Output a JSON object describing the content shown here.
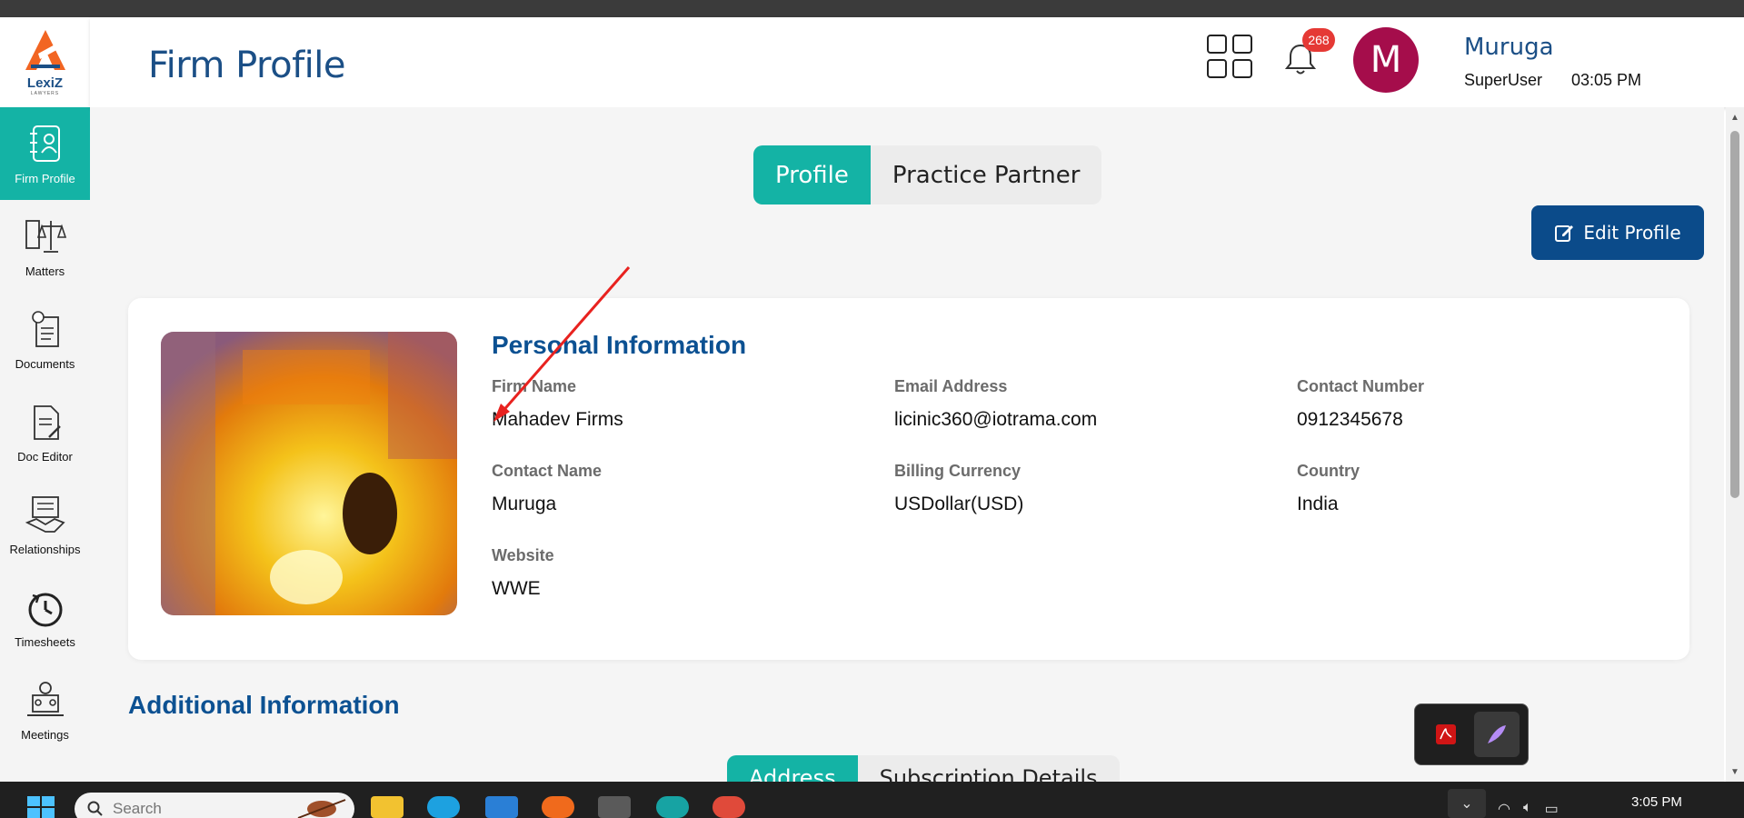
{
  "app": {
    "brand": "LexiZ",
    "tagline": "LAWYERS"
  },
  "header": {
    "title": "Firm Profile",
    "notifications_count": "268",
    "avatar_initial": "M",
    "user_name": "Muruga",
    "user_role": "SuperUser",
    "time": "03:05 PM"
  },
  "sidebar": {
    "items": [
      {
        "label": "Firm Profile",
        "icon": "contact-book-icon",
        "active": true
      },
      {
        "label": "Matters",
        "icon": "scales-icon"
      },
      {
        "label": "Documents",
        "icon": "documents-icon"
      },
      {
        "label": "Doc Editor",
        "icon": "doc-editor-icon"
      },
      {
        "label": "Relationships",
        "icon": "handshake-icon"
      },
      {
        "label": "Timesheets",
        "icon": "clock-icon"
      },
      {
        "label": "Meetings",
        "icon": "meeting-icon"
      }
    ]
  },
  "tabs": {
    "profile": "Profile",
    "practice_partner": "Practice Partner"
  },
  "edit_profile": "Edit Profile",
  "personal": {
    "title": "Personal Information",
    "fields": [
      {
        "label": "Firm Name",
        "value": "Mahadev Firms"
      },
      {
        "label": "Email Address",
        "value": "licinic360@iotrama.com"
      },
      {
        "label": "Contact Number",
        "value": "0912345678"
      },
      {
        "label": "Contact Name",
        "value": "Muruga"
      },
      {
        "label": "Billing Currency",
        "value": "USDollar(USD)"
      },
      {
        "label": "Country",
        "value": "India"
      },
      {
        "label": "Website",
        "value": "WWE"
      }
    ]
  },
  "additional": {
    "title": "Additional Information",
    "tabs": [
      "Address",
      "Subscription Details"
    ]
  },
  "taskbar": {
    "search_placeholder": "Search",
    "clock": "3:05 PM"
  },
  "colors": {
    "accent": "#14b3a5",
    "primary": "#0b4b8a",
    "title_blue": "#1b4f86",
    "avatar": "#a50d4b",
    "badge": "#e53935"
  }
}
